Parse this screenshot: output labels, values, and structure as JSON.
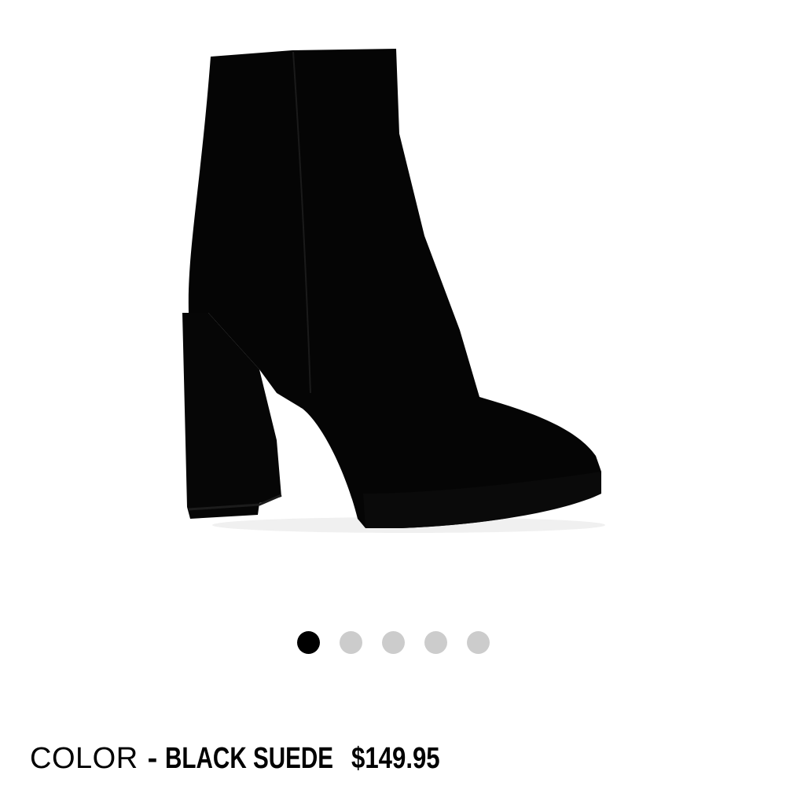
{
  "product": {
    "image_alt": "black suede platform ankle boot",
    "color_label": "COLOR",
    "color_separator": "-",
    "color_value": "BLACK SUEDE",
    "price": "$149.95"
  },
  "gallery": {
    "total_images": 5,
    "active_index": 0
  },
  "colors": {
    "boot": "#050505",
    "dot_active": "#000000",
    "dot_inactive": "#cccccc",
    "background": "#ffffff"
  }
}
